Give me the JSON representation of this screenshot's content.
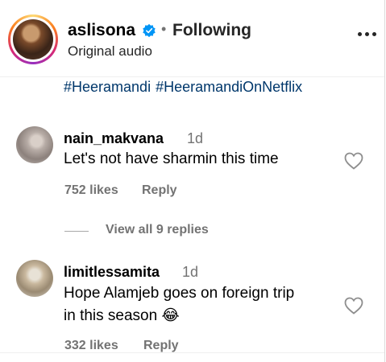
{
  "post_header": {
    "username": "aslisona",
    "separator": "•",
    "follow_status": "Following",
    "audio_label": "Original audio"
  },
  "caption": {
    "hashtags": [
      "#Heeramandi",
      "#HeeramandiOnNetflix"
    ]
  },
  "comments": [
    {
      "username": "nain_makvana",
      "time": "1d",
      "text_lines": [
        "Let's not have sharmin this time"
      ],
      "likes": "752 likes",
      "reply_label": "Reply"
    },
    {
      "username": "limitlessamita",
      "time": "1d",
      "text_lines": [
        "Hope Alamjeb goes on foreign trip",
        "in this season 😂"
      ],
      "likes": "332 likes",
      "reply_label": "Reply"
    }
  ],
  "view_replies": {
    "label": "View all 9 replies"
  },
  "icons": {
    "verified": "verified-badge-icon",
    "more": "more-options-icon",
    "like": "heart-icon"
  },
  "colors": {
    "link": "#00376b",
    "verified": "#0095f6",
    "muted": "#737373"
  }
}
